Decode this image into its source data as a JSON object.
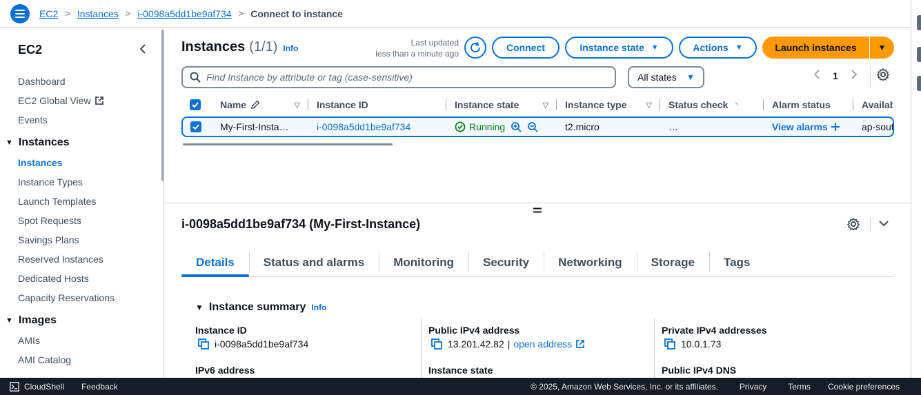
{
  "breadcrumb": {
    "items": [
      "EC2",
      "Instances",
      "i-0098a5dd1be9af734"
    ],
    "current": "Connect to instance"
  },
  "sidebar": {
    "title": "EC2",
    "top_links": [
      "Dashboard",
      "EC2 Global View",
      "Events"
    ],
    "sections": [
      {
        "title": "Instances",
        "items": [
          "Instances",
          "Instance Types",
          "Launch Templates",
          "Spot Requests",
          "Savings Plans",
          "Reserved Instances",
          "Dedicated Hosts",
          "Capacity Reservations"
        ]
      },
      {
        "title": "Images",
        "items": [
          "AMIs",
          "AMI Catalog"
        ]
      }
    ]
  },
  "instances": {
    "title": "Instances",
    "count": "(1/1)",
    "info": "Info",
    "last_updated_line1": "Last updated",
    "last_updated_line2": "less than a minute ago",
    "connect_label": "Connect",
    "instance_state_label": "Instance state",
    "actions_label": "Actions",
    "launch_label": "Launch instances",
    "search_placeholder": "Find Instance by attribute or tag (case-sensitive)",
    "filter_value": "All states",
    "page": "1"
  },
  "table": {
    "columns": [
      "Name",
      "Instance ID",
      "Instance state",
      "Instance type",
      "Status check",
      "Alarm status",
      "Availab"
    ],
    "row": {
      "name": "My-First-Insta…",
      "instance_id": "i-0098a5dd1be9af734",
      "state": "Running",
      "type": "t2.micro",
      "status_check": "…",
      "alarm": "View alarms",
      "az": "ap-sout"
    }
  },
  "details": {
    "title": "i-0098a5dd1be9af734 (My-First-Instance)",
    "tabs": [
      "Details",
      "Status and alarms",
      "Monitoring",
      "Security",
      "Networking",
      "Storage",
      "Tags"
    ],
    "summary_title": "Instance summary",
    "summary_info": "Info",
    "col1": {
      "label1": "Instance ID",
      "value1": "i-0098a5dd1be9af734",
      "label2": "IPv6 address"
    },
    "col2": {
      "label1": "Public IPv4 address",
      "value1": "13.201.42.82",
      "value1_sep": "|",
      "open_address": "open address",
      "label2": "Instance state"
    },
    "col3": {
      "label1": "Private IPv4 addresses",
      "value1": "10.0.1.73",
      "label2": "Public IPv4 DNS"
    }
  },
  "footer": {
    "cloudshell": "CloudShell",
    "feedback": "Feedback",
    "copyright": "© 2025, Amazon Web Services, Inc. or its affiliates.",
    "privacy": "Privacy",
    "terms": "Terms",
    "cookies": "Cookie preferences"
  },
  "colors": {
    "accent": "#0972d3",
    "launch": "#ff9900",
    "running": "#037f0c",
    "footer_bg": "#161d26"
  }
}
